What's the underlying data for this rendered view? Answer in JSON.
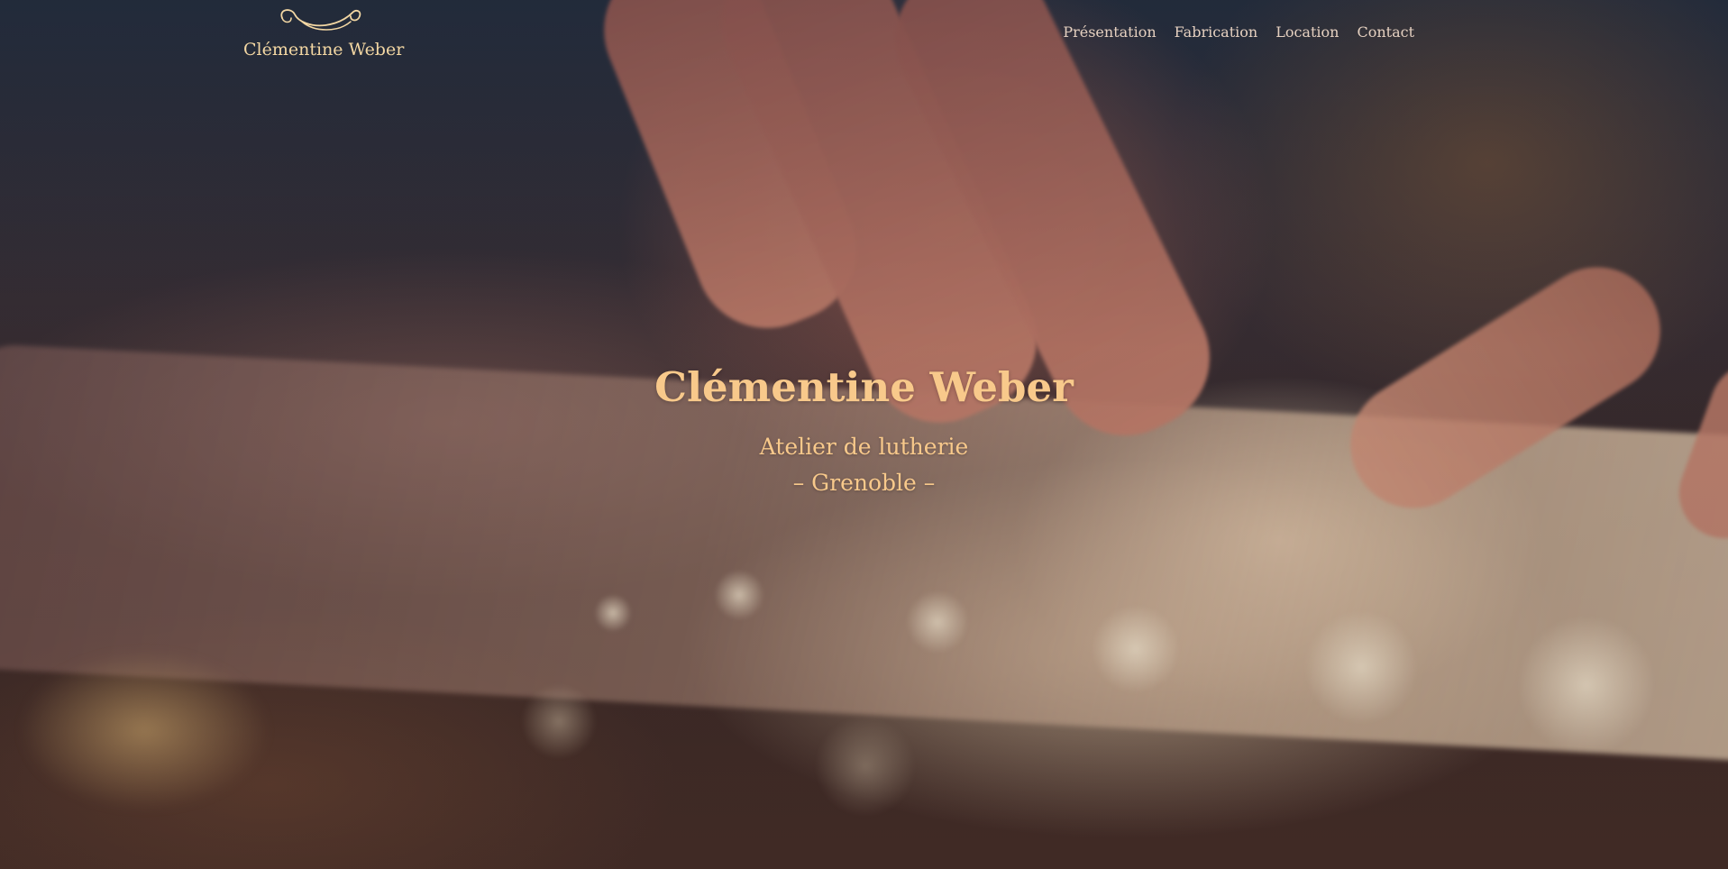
{
  "header": {
    "logo_text": "Clémentine Weber",
    "nav": [
      {
        "label": "Présentation"
      },
      {
        "label": "Fabrication"
      },
      {
        "label": "Location"
      },
      {
        "label": "Contact"
      }
    ]
  },
  "hero": {
    "title": "Clémentine Weber",
    "subtitle": "Atelier de lutherie",
    "location": "– Grenoble –",
    "background_image": "hand-carving-wood-shavings-photo"
  },
  "colors": {
    "title": "#f8c98b",
    "logo": "#f3d7a3",
    "nav": "#e5d0c0"
  }
}
